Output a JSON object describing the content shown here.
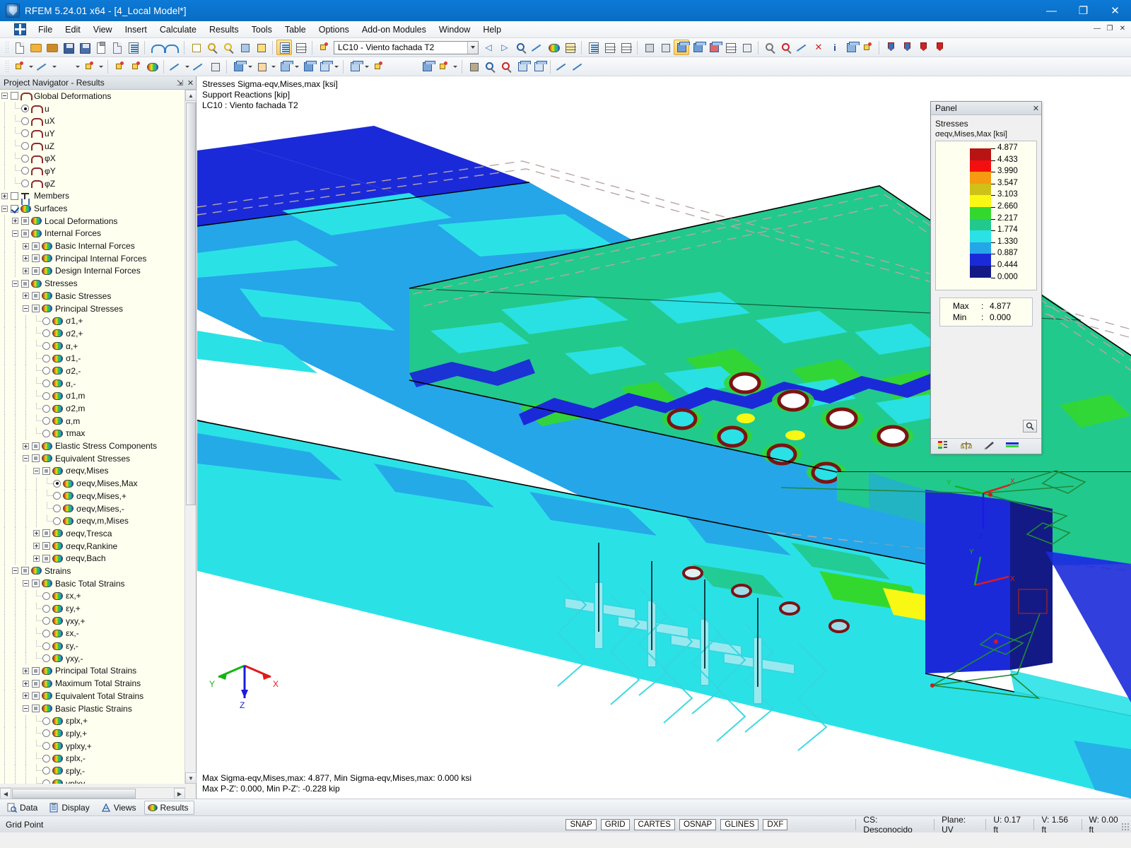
{
  "window": {
    "title": "RFEM 5.24.01 x64 - [4_Local Model*]",
    "minimize": "—",
    "maximize": "❐",
    "close": "✕",
    "mdi_minimize": "—",
    "mdi_restore": "❐",
    "mdi_close": "✕"
  },
  "menu": {
    "items": [
      "File",
      "Edit",
      "View",
      "Insert",
      "Calculate",
      "Results",
      "Tools",
      "Table",
      "Options",
      "Add-on Modules",
      "Window",
      "Help"
    ]
  },
  "toolbar": {
    "load_case": "LC10 - Viento fachada T2",
    "prev_label": "◁",
    "next_label": "▷"
  },
  "navigator": {
    "title": "Project Navigator - Results",
    "pin": "⇲",
    "close": "✕",
    "tree": [
      {
        "indent": 0,
        "toggle": "minus",
        "ctrl": "check",
        "icon": "def",
        "label": "Global Deformations"
      },
      {
        "indent": 1,
        "toggle": "none",
        "ctrl": "radio-on",
        "icon": "def",
        "label": "u"
      },
      {
        "indent": 1,
        "toggle": "none",
        "ctrl": "radio",
        "icon": "def",
        "label": "uX"
      },
      {
        "indent": 1,
        "toggle": "none",
        "ctrl": "radio",
        "icon": "def",
        "label": "uY"
      },
      {
        "indent": 1,
        "toggle": "none",
        "ctrl": "radio",
        "icon": "def",
        "label": "uZ"
      },
      {
        "indent": 1,
        "toggle": "none",
        "ctrl": "radio",
        "icon": "def",
        "label": "φX"
      },
      {
        "indent": 1,
        "toggle": "none",
        "ctrl": "radio",
        "icon": "def",
        "label": "φY"
      },
      {
        "indent": 1,
        "toggle": "none",
        "ctrl": "radio",
        "icon": "def",
        "label": "φZ"
      },
      {
        "indent": 0,
        "toggle": "plus",
        "ctrl": "check",
        "icon": "mem",
        "label": "Members"
      },
      {
        "indent": 0,
        "toggle": "minus",
        "ctrl": "checked",
        "icon": "surf",
        "label": "Surfaces"
      },
      {
        "indent": 1,
        "toggle": "plus",
        "ctrl": "gray",
        "icon": "surf",
        "label": "Local Deformations"
      },
      {
        "indent": 1,
        "toggle": "minus",
        "ctrl": "gray",
        "icon": "surf",
        "label": "Internal Forces"
      },
      {
        "indent": 2,
        "toggle": "plus",
        "ctrl": "gray",
        "icon": "surf",
        "label": "Basic Internal Forces"
      },
      {
        "indent": 2,
        "toggle": "plus",
        "ctrl": "gray",
        "icon": "surf",
        "label": "Principal Internal Forces"
      },
      {
        "indent": 2,
        "toggle": "plus",
        "ctrl": "gray",
        "icon": "surf",
        "label": "Design Internal Forces"
      },
      {
        "indent": 1,
        "toggle": "minus",
        "ctrl": "gray",
        "icon": "surf",
        "label": "Stresses"
      },
      {
        "indent": 2,
        "toggle": "plus",
        "ctrl": "gray",
        "icon": "surf",
        "label": "Basic Stresses"
      },
      {
        "indent": 2,
        "toggle": "minus",
        "ctrl": "gray",
        "icon": "surf",
        "label": "Principal Stresses"
      },
      {
        "indent": 3,
        "toggle": "none",
        "ctrl": "radio",
        "icon": "surf",
        "label": "σ1,+"
      },
      {
        "indent": 3,
        "toggle": "none",
        "ctrl": "radio",
        "icon": "surf",
        "label": "σ2,+"
      },
      {
        "indent": 3,
        "toggle": "none",
        "ctrl": "radio",
        "icon": "surf",
        "label": "α,+"
      },
      {
        "indent": 3,
        "toggle": "none",
        "ctrl": "radio",
        "icon": "surf",
        "label": "σ1,-"
      },
      {
        "indent": 3,
        "toggle": "none",
        "ctrl": "radio",
        "icon": "surf",
        "label": "σ2,-"
      },
      {
        "indent": 3,
        "toggle": "none",
        "ctrl": "radio",
        "icon": "surf",
        "label": "α,-"
      },
      {
        "indent": 3,
        "toggle": "none",
        "ctrl": "radio",
        "icon": "surf",
        "label": "σ1,m"
      },
      {
        "indent": 3,
        "toggle": "none",
        "ctrl": "radio",
        "icon": "surf",
        "label": "σ2,m"
      },
      {
        "indent": 3,
        "toggle": "none",
        "ctrl": "radio",
        "icon": "surf",
        "label": "α,m"
      },
      {
        "indent": 3,
        "toggle": "none",
        "ctrl": "radio",
        "icon": "surf",
        "label": "τmax"
      },
      {
        "indent": 2,
        "toggle": "plus",
        "ctrl": "gray",
        "icon": "surf",
        "label": "Elastic Stress Components"
      },
      {
        "indent": 2,
        "toggle": "minus",
        "ctrl": "gray",
        "icon": "surf",
        "label": "Equivalent Stresses"
      },
      {
        "indent": 3,
        "toggle": "minus",
        "ctrl": "gray",
        "icon": "surf",
        "label": "σeqv,Mises"
      },
      {
        "indent": 4,
        "toggle": "none",
        "ctrl": "radio-on",
        "icon": "surf",
        "label": "σeqv,Mises,Max"
      },
      {
        "indent": 4,
        "toggle": "none",
        "ctrl": "radio",
        "icon": "surf",
        "label": "σeqv,Mises,+"
      },
      {
        "indent": 4,
        "toggle": "none",
        "ctrl": "radio",
        "icon": "surf",
        "label": "σeqv,Mises,-"
      },
      {
        "indent": 4,
        "toggle": "none",
        "ctrl": "radio",
        "icon": "surf",
        "label": "σeqv,m,Mises"
      },
      {
        "indent": 3,
        "toggle": "plus",
        "ctrl": "gray",
        "icon": "surf",
        "label": "σeqv,Tresca"
      },
      {
        "indent": 3,
        "toggle": "plus",
        "ctrl": "gray",
        "icon": "surf",
        "label": "σeqv,Rankine"
      },
      {
        "indent": 3,
        "toggle": "plus",
        "ctrl": "gray",
        "icon": "surf",
        "label": "σeqv,Bach"
      },
      {
        "indent": 1,
        "toggle": "minus",
        "ctrl": "gray",
        "icon": "surf",
        "label": "Strains"
      },
      {
        "indent": 2,
        "toggle": "minus",
        "ctrl": "gray",
        "icon": "surf",
        "label": "Basic Total Strains"
      },
      {
        "indent": 3,
        "toggle": "none",
        "ctrl": "radio",
        "icon": "surf",
        "label": "εx,+"
      },
      {
        "indent": 3,
        "toggle": "none",
        "ctrl": "radio",
        "icon": "surf",
        "label": "εy,+"
      },
      {
        "indent": 3,
        "toggle": "none",
        "ctrl": "radio",
        "icon": "surf",
        "label": "γxy,+"
      },
      {
        "indent": 3,
        "toggle": "none",
        "ctrl": "radio",
        "icon": "surf",
        "label": "εx,-"
      },
      {
        "indent": 3,
        "toggle": "none",
        "ctrl": "radio",
        "icon": "surf",
        "label": "εy,-"
      },
      {
        "indent": 3,
        "toggle": "none",
        "ctrl": "radio",
        "icon": "surf",
        "label": "γxy,-"
      },
      {
        "indent": 2,
        "toggle": "plus",
        "ctrl": "gray",
        "icon": "surf",
        "label": "Principal Total Strains"
      },
      {
        "indent": 2,
        "toggle": "plus",
        "ctrl": "gray",
        "icon": "surf",
        "label": "Maximum Total Strains"
      },
      {
        "indent": 2,
        "toggle": "plus",
        "ctrl": "gray",
        "icon": "surf",
        "label": "Equivalent Total Strains"
      },
      {
        "indent": 2,
        "toggle": "minus",
        "ctrl": "gray",
        "icon": "surf",
        "label": "Basic Plastic Strains"
      },
      {
        "indent": 3,
        "toggle": "none",
        "ctrl": "radio",
        "icon": "surf",
        "label": "εplx,+"
      },
      {
        "indent": 3,
        "toggle": "none",
        "ctrl": "radio",
        "icon": "surf",
        "label": "εply,+"
      },
      {
        "indent": 3,
        "toggle": "none",
        "ctrl": "radio",
        "icon": "surf",
        "label": "γplxy,+"
      },
      {
        "indent": 3,
        "toggle": "none",
        "ctrl": "radio",
        "icon": "surf",
        "label": "εplx,-"
      },
      {
        "indent": 3,
        "toggle": "none",
        "ctrl": "radio",
        "icon": "surf",
        "label": "εply,-"
      },
      {
        "indent": 3,
        "toggle": "none",
        "ctrl": "radio",
        "icon": "surf",
        "label": "γplxy,-"
      }
    ]
  },
  "viewport": {
    "header_lines": [
      "Stresses Sigma-eqv,Mises,max [ksi]",
      "Support Reactions [kip]",
      "LC10 : Viento fachada T2"
    ],
    "footer_lines": [
      "Max Sigma-eqv,Mises,max: 4.877, Min Sigma-eqv,Mises,max: 0.000 ksi",
      "Max P-Z': 0.000, Min P-Z': -0.228 kip"
    ],
    "axes": {
      "x": "X",
      "y": "Y",
      "z": "Z"
    }
  },
  "panel": {
    "title": "Panel",
    "close": "✕",
    "section_label": "Stresses",
    "quantity": "σeqv,Mises,Max",
    "unit": "[ksi]",
    "legend_values": [
      "4.877",
      "4.433",
      "3.990",
      "3.547",
      "3.103",
      "2.660",
      "2.217",
      "1.774",
      "1.330",
      "0.887",
      "0.444",
      "0.000"
    ],
    "legend_colors": [
      "#b81414",
      "#f40f0f",
      "#f59a11",
      "#cfc117",
      "#f8f814",
      "#33d82f",
      "#22c98c",
      "#2ae2e6",
      "#25a6e8",
      "#1b2ad8",
      "#131a86"
    ],
    "max_key": "Max",
    "min_key": "Min",
    "colon": ":",
    "max_value": "4.877",
    "min_value": "0.000",
    "zoom_icon": "🔍"
  },
  "bottom_tabs": {
    "items": [
      {
        "label": "Data",
        "icon": "data-icon",
        "active": false
      },
      {
        "label": "Display",
        "icon": "display-icon",
        "active": false
      },
      {
        "label": "Views",
        "icon": "views-icon",
        "active": false
      },
      {
        "label": "Results",
        "icon": "results-icon",
        "active": true
      }
    ]
  },
  "statusbar": {
    "message": "Grid Point",
    "chips": [
      "SNAP",
      "GRID",
      "CARTES",
      "OSNAP",
      "GLINES",
      "DXF"
    ],
    "cs": "CS: Desconocido",
    "plane": "Plane: UV",
    "u": "U:  0.17 ft",
    "v": "V:  1.56 ft",
    "w": "W:  0.00 ft"
  },
  "colors": {
    "title_bar": "#0a6cc2",
    "accent_legend_max": "#b81414",
    "accent_legend_min": "#131a86"
  }
}
